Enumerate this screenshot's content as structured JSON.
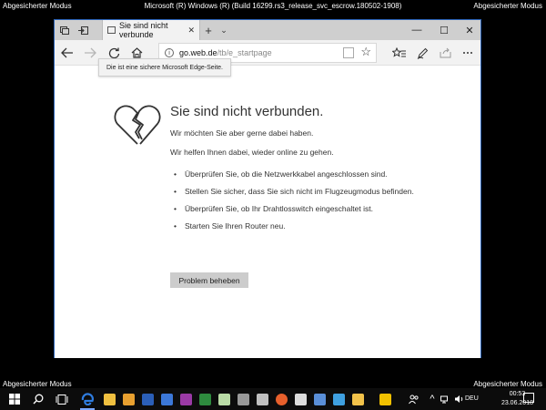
{
  "desktop": {
    "safe_mode_label": "Abgesicherter Modus",
    "build_text": "Microsoft (R) Windows (R) (Build 16299.rs3_release_svc_escrow.180502-1908)"
  },
  "browser": {
    "tab_title": "Sie sind nicht verbunde",
    "tab_close": "✕",
    "new_tab": "+",
    "tab_list": "⌄",
    "window_controls": {
      "minimize": "—",
      "maximize": "☐",
      "close": "✕"
    },
    "address": {
      "host": "go.web.de",
      "path": "/tb/e_startpage"
    },
    "tooltip": "Die ist eine sichere Microsoft Edge-Seite."
  },
  "page": {
    "heading": "Sie sind nicht verbunden.",
    "para1": "Wir möchten Sie aber gerne dabei haben.",
    "para2": "Wir helfen Ihnen dabei, wieder online zu gehen.",
    "tips": [
      "Überprüfen Sie, ob die Netzwerkkabel angeschlossen sind.",
      "Stellen Sie sicher, dass Sie sich nicht im Flugzeugmodus befinden.",
      "Überprüfen Sie, ob Ihr Drahtlosswitch eingeschaltet ist.",
      "Starten Sie Ihren Router neu."
    ],
    "fix_button": "Problem beheben"
  },
  "taskbar": {
    "language": "DEU",
    "time": "00:53",
    "date": "23.06.2018",
    "app_colors": {
      "edge": "#2f7de1",
      "explorer": "#f0c040",
      "accent": "#7aa7ff"
    }
  }
}
